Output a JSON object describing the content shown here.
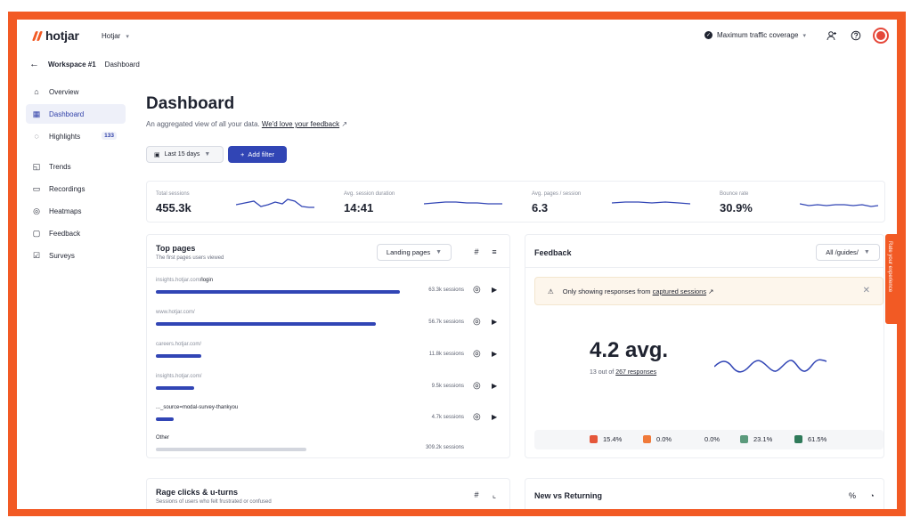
{
  "topbar": {
    "logo_text": "hotjar",
    "org": "Hotjar",
    "coverage": "Maximum traffic coverage"
  },
  "breadcrumb": {
    "workspace": "Workspace #1",
    "page": "Dashboard"
  },
  "sidebar": {
    "items": [
      {
        "label": "Overview",
        "icon": "home-icon"
      },
      {
        "label": "Dashboard",
        "icon": "dashboard-icon"
      },
      {
        "label": "Highlights",
        "icon": "lightbulb-icon",
        "badge": "133"
      },
      {
        "label": "Trends",
        "icon": "trends-icon"
      },
      {
        "label": "Recordings",
        "icon": "recordings-icon"
      },
      {
        "label": "Heatmaps",
        "icon": "heatmaps-icon"
      },
      {
        "label": "Feedback",
        "icon": "feedback-icon"
      },
      {
        "label": "Surveys",
        "icon": "surveys-icon"
      }
    ]
  },
  "main": {
    "title": "Dashboard",
    "subtitle": "An aggregated view of all your data.",
    "feedback_link": "We'd love your feedback",
    "date_range": "Last 15 days",
    "add_filter": "Add filter"
  },
  "kpis": [
    {
      "label": "Total sessions",
      "value": "455.3k"
    },
    {
      "label": "Avg. session duration",
      "value": "14:41"
    },
    {
      "label": "Avg. pages / session",
      "value": "6.3"
    },
    {
      "label": "Bounce rate",
      "value": "30.9%"
    }
  ],
  "top_pages": {
    "title": "Top pages",
    "subtitle": "The first pages users viewed",
    "select": "Landing pages",
    "rows": [
      {
        "url_prefix": "insights.hotjar.com",
        "url_path": "/login",
        "sessions": "63.3k sessions",
        "share": 0.7
      },
      {
        "url_prefix": "www.hotjar.com/",
        "url_path": "",
        "sessions": "56.7k sessions",
        "share": 0.63
      },
      {
        "url_prefix": "careers.hotjar.com/",
        "url_path": "",
        "sessions": "11.8k sessions",
        "share": 0.13
      },
      {
        "url_prefix": "insights.hotjar.com/",
        "url_path": "",
        "sessions": "9.5k sessions",
        "share": 0.11
      },
      {
        "url_prefix": "",
        "url_path": "..._source=modal-survey-thankyou",
        "sessions": "4.7k sessions",
        "share": 0.05
      },
      {
        "url_prefix": "",
        "url_path": "Other",
        "sessions": "309.2k sessions",
        "share": 0.43,
        "grey": true
      }
    ]
  },
  "feedback": {
    "title": "Feedback",
    "select": "All /guides/",
    "notice_text": "Only showing responses from",
    "notice_link": "captured sessions",
    "avg": "4.2 avg.",
    "responses_prefix": "13 out of",
    "responses_link": "267 responses",
    "ratings": [
      {
        "value": "15.4%",
        "color": "#e5573a"
      },
      {
        "value": "0.0%",
        "color": "#f07a3a"
      },
      {
        "value": "0.0%",
        "color": "#f5f6f8"
      },
      {
        "value": "23.1%",
        "color": "#5b9a7c"
      },
      {
        "value": "61.5%",
        "color": "#2f7a5a"
      }
    ]
  },
  "rage": {
    "title": "Rage clicks & u-turns",
    "subtitle": "Sessions of users who felt frustrated or confused"
  },
  "new_vs_returning": {
    "title": "New vs Returning"
  },
  "rate_tab": "Rate your experience",
  "colors": {
    "accent": "#3145b5",
    "brand": "#f25a24"
  }
}
